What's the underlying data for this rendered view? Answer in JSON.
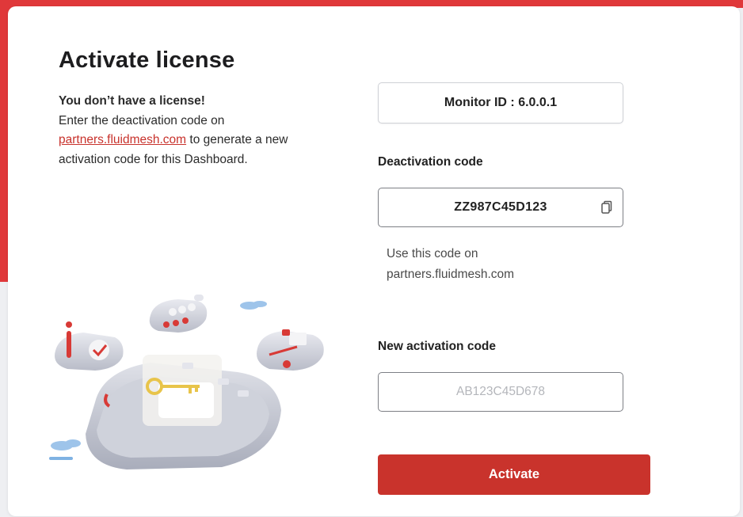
{
  "dialog": {
    "title": "Activate license",
    "no_license": "You don’t have a license!",
    "desc_part1": "Enter the deactivation code on",
    "link_text": "partners.fluidmesh.com",
    "desc_part2": " to generate a new activation code for this Dashboard."
  },
  "monitor": {
    "label": "Monitor ID : 6.0.0.1"
  },
  "deactivation": {
    "label": "Deactivation code",
    "code": "ZZ987C45D123",
    "hint": "Use this code on partners.fluidmesh.com",
    "copy_icon": "copy-icon"
  },
  "activation": {
    "label": "New activation code",
    "placeholder": "AB123C45D678",
    "value": ""
  },
  "actions": {
    "activate_label": "Activate"
  },
  "colors": {
    "accent": "#c9332c",
    "link": "#c8322c",
    "top_strip": "#e0383a"
  }
}
